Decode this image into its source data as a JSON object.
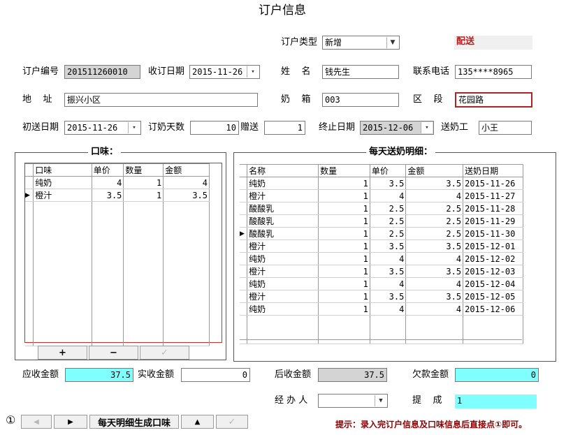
{
  "title": "订户信息",
  "header": {
    "order_type_label": "订户类型",
    "order_type_value": "新增",
    "delivery_label": "配送"
  },
  "row1": {
    "order_no_label": "订户编号",
    "order_no": "201511260010",
    "order_date_label": "收订日期",
    "order_date": "2015-11-26",
    "name_label": "姓    名",
    "name": "钱先生",
    "phone_label": "联系电话",
    "phone": "135****8965"
  },
  "row2": {
    "address_label": "地    址",
    "address": "振兴小区",
    "box_label": "奶    箱",
    "box": "003",
    "zone_label": "区    段",
    "zone": "花园路"
  },
  "row3": {
    "start_label": "初送日期",
    "start": "2015-11-26",
    "days_label": "订奶天数",
    "days": "10",
    "gift_label": "赠送",
    "gift": "1",
    "end_label": "终止日期",
    "end": "2015-12-06",
    "courier_label": "送奶工",
    "courier": "小王"
  },
  "flavor": {
    "title": "口味：",
    "headers": [
      "口味",
      "单价",
      "数量",
      "金额"
    ],
    "rows": [
      {
        "name": "纯奶",
        "price": "4",
        "qty": "1",
        "amount": "4"
      },
      {
        "name": "橙汁",
        "price": "3.5",
        "qty": "1",
        "amount": "3.5"
      }
    ],
    "add_label": "+",
    "remove_label": "−",
    "confirm_label": "✓"
  },
  "daily": {
    "title": "每天送奶明细：",
    "headers": [
      "名称",
      "数量",
      "单价",
      "金额",
      "送奶日期"
    ],
    "rows": [
      {
        "name": "纯奶",
        "qty": "1",
        "price": "3.5",
        "amount": "3.5",
        "date": "2015-11-26"
      },
      {
        "name": "橙汁",
        "qty": "1",
        "price": "4",
        "amount": "4",
        "date": "2015-11-27"
      },
      {
        "name": "酸酸乳",
        "qty": "1",
        "price": "2.5",
        "amount": "2.5",
        "date": "2015-11-28"
      },
      {
        "name": "酸酸乳",
        "qty": "1",
        "price": "2.5",
        "amount": "2.5",
        "date": "2015-11-29"
      },
      {
        "name": "酸酸乳",
        "qty": "1",
        "price": "2.5",
        "amount": "2.5",
        "date": "2015-11-30"
      },
      {
        "name": "橙汁",
        "qty": "1",
        "price": "3.5",
        "amount": "3.5",
        "date": "2015-12-01"
      },
      {
        "name": "纯奶",
        "qty": "1",
        "price": "4",
        "amount": "4",
        "date": "2015-12-02"
      },
      {
        "name": "橙汁",
        "qty": "1",
        "price": "3.5",
        "amount": "3.5",
        "date": "2015-12-03"
      },
      {
        "name": "纯奶",
        "qty": "1",
        "price": "4",
        "amount": "4",
        "date": "2015-12-04"
      },
      {
        "name": "橙汁",
        "qty": "1",
        "price": "3.5",
        "amount": "3.5",
        "date": "2015-12-05"
      },
      {
        "name": "纯奶",
        "qty": "1",
        "price": "4",
        "amount": "4",
        "date": "2015-12-06"
      }
    ]
  },
  "totals": {
    "receivable_label": "应收金额",
    "receivable": "37.5",
    "received_label": "实收金额",
    "received": "0",
    "after_label": "后收金额",
    "after": "37.5",
    "owed_label": "欠款金额",
    "owed": "0",
    "handler_label": "经 办 人",
    "handler": "",
    "commission_label": "提    成",
    "commission": "1"
  },
  "footer": {
    "marker": "①",
    "prev_label": "◀",
    "next_label": "▶",
    "generate_label": "每天明细生成口味",
    "up_label": "▲",
    "check_label": "✓",
    "hint": "提示：录入完订户信息及口味信息后直接点①即可。"
  },
  "colors": {
    "cyan": "#80ffff",
    "gray": "#d4d4d4",
    "red": "#b22222",
    "hint": "#8b0000"
  }
}
